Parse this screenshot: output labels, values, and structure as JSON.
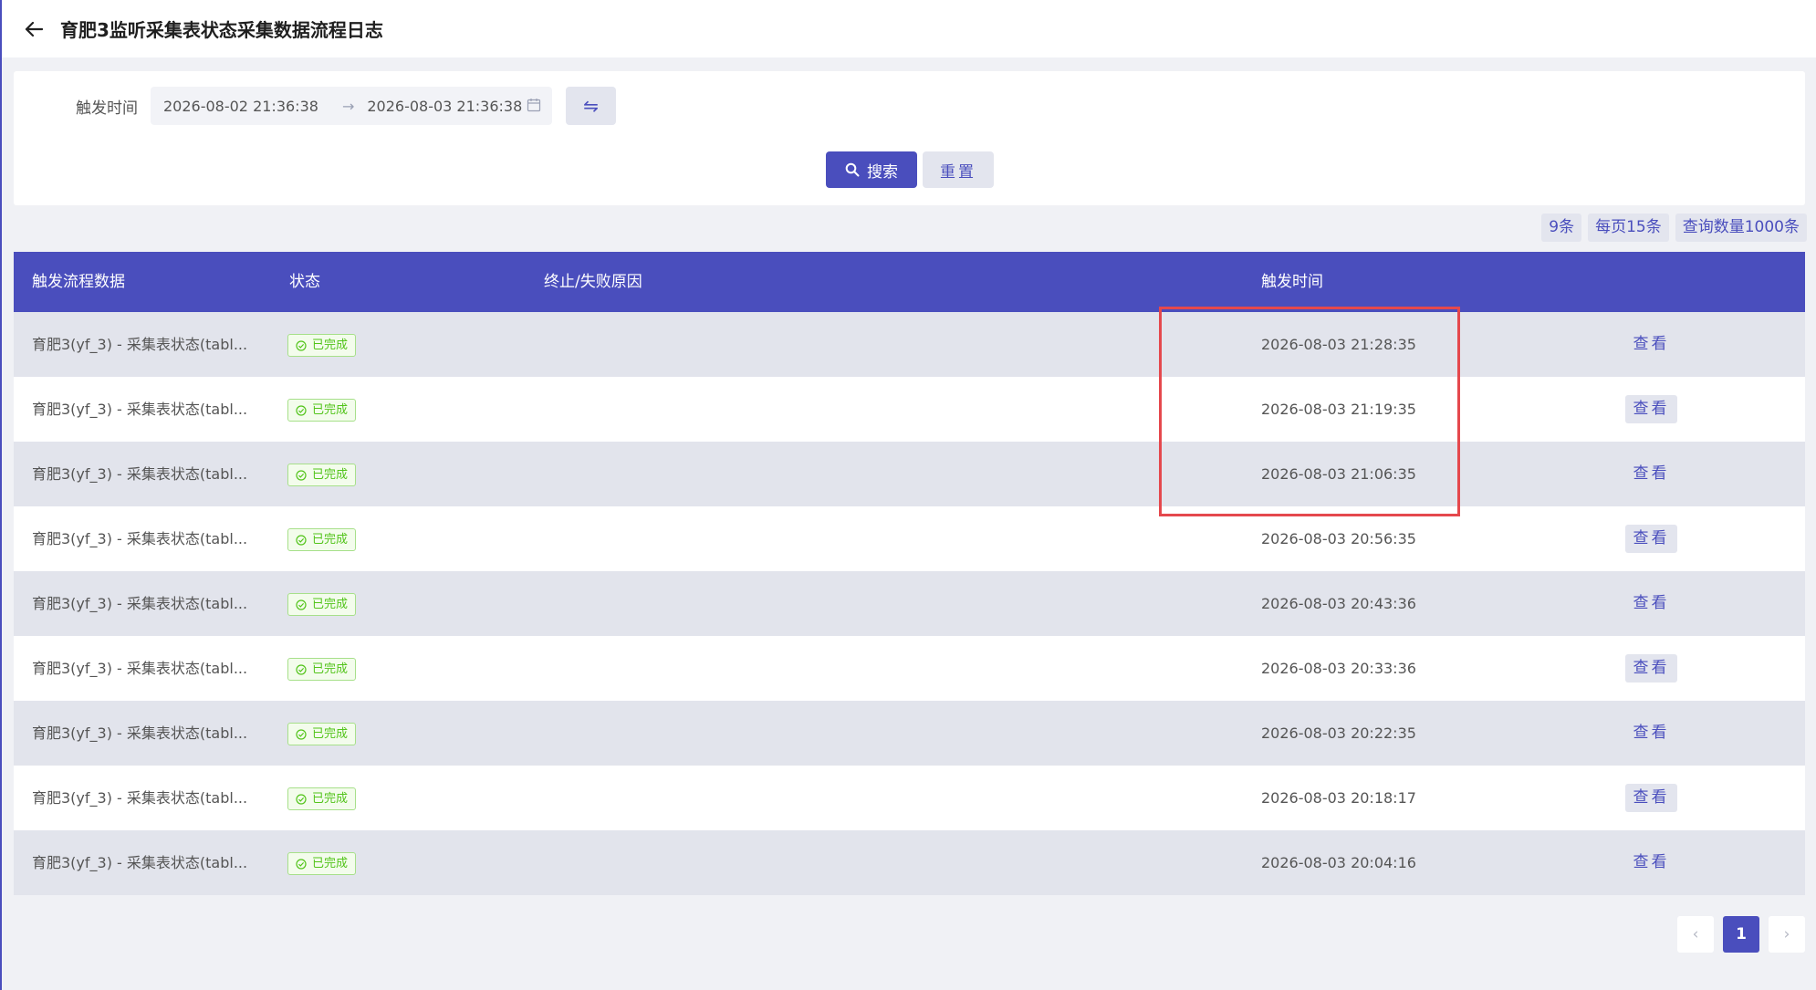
{
  "header": {
    "title": "育肥3监听采集表状态采集数据流程日志"
  },
  "filter": {
    "label": "触发时间",
    "start": "2026-08-02 21:36:38",
    "separator": "→",
    "end": "2026-08-03 21:36:38",
    "swap_icon": "⇋",
    "search_label": "搜索",
    "reset_label": "重置"
  },
  "stats": {
    "total": "9条",
    "per_page": "每页15条",
    "query_limit": "查询数量1000条"
  },
  "table": {
    "headers": [
      "触发流程数据",
      "状态",
      "终止/失败原因",
      "触发时间"
    ],
    "rows": [
      {
        "flow": "育肥3(yf_3) - 采集表状态(tabl...",
        "status": "已完成",
        "reason": "",
        "time": "2026-08-03 21:28:35",
        "action": "查看"
      },
      {
        "flow": "育肥3(yf_3) - 采集表状态(tabl...",
        "status": "已完成",
        "reason": "",
        "time": "2026-08-03 21:19:35",
        "action": "查看"
      },
      {
        "flow": "育肥3(yf_3) - 采集表状态(tabl...",
        "status": "已完成",
        "reason": "",
        "time": "2026-08-03 21:06:35",
        "action": "查看"
      },
      {
        "flow": "育肥3(yf_3) - 采集表状态(tabl...",
        "status": "已完成",
        "reason": "",
        "time": "2026-08-03 20:56:35",
        "action": "查看"
      },
      {
        "flow": "育肥3(yf_3) - 采集表状态(tabl...",
        "status": "已完成",
        "reason": "",
        "time": "2026-08-03 20:43:36",
        "action": "查看"
      },
      {
        "flow": "育肥3(yf_3) - 采集表状态(tabl...",
        "status": "已完成",
        "reason": "",
        "time": "2026-08-03 20:33:36",
        "action": "查看"
      },
      {
        "flow": "育肥3(yf_3) - 采集表状态(tabl...",
        "status": "已完成",
        "reason": "",
        "time": "2026-08-03 20:22:35",
        "action": "查看"
      },
      {
        "flow": "育肥3(yf_3) - 采集表状态(tabl...",
        "status": "已完成",
        "reason": "",
        "time": "2026-08-03 20:18:17",
        "action": "查看"
      },
      {
        "flow": "育肥3(yf_3) - 采集表状态(tabl...",
        "status": "已完成",
        "reason": "",
        "time": "2026-08-03 20:04:16",
        "action": "查看"
      }
    ]
  },
  "pagination": {
    "prev": "‹",
    "current": "1",
    "next": "›"
  },
  "colors": {
    "accent": "#4a4ebd",
    "success": "#52c41a",
    "highlight": "#e5484d"
  }
}
